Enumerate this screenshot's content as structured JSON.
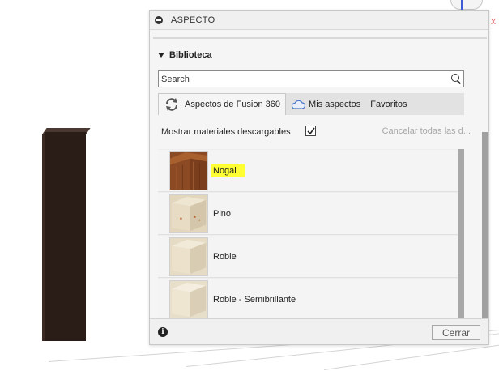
{
  "dialog": {
    "title": "ASPECTO",
    "section_title": "Biblioteca",
    "search": {
      "placeholder": "Search",
      "value": ""
    },
    "tabs": [
      {
        "label": "Aspectos de Fusion 360",
        "active": true,
        "icon": "refresh-icon"
      },
      {
        "label": "Mis aspectos",
        "active": false,
        "icon": "cloud-icon"
      },
      {
        "label": "Favoritos",
        "active": false
      }
    ],
    "show_downloadable": {
      "label": "Mostrar materiales descargables",
      "checked": true
    },
    "cancel_all_label": "Cancelar todas las d...",
    "materials": [
      {
        "name": "Nogal",
        "highlighted": true,
        "color": "#8b4a24"
      },
      {
        "name": "Pino",
        "highlighted": false,
        "color": "#e8dcc4"
      },
      {
        "name": "Roble",
        "highlighted": false,
        "color": "#ece2cc"
      },
      {
        "name": "Roble - Semibrillante",
        "highlighted": false,
        "color": "#efe6d2"
      }
    ],
    "close_label": "Cerrar",
    "info_icon": "info-icon"
  },
  "viewport": {
    "axis_x_label": "X",
    "axis_colors": {
      "x": "#e05050",
      "y": "#3c5cd6"
    },
    "model_color": "#2a1c17"
  },
  "colors": {
    "highlight": "#ffff33"
  }
}
